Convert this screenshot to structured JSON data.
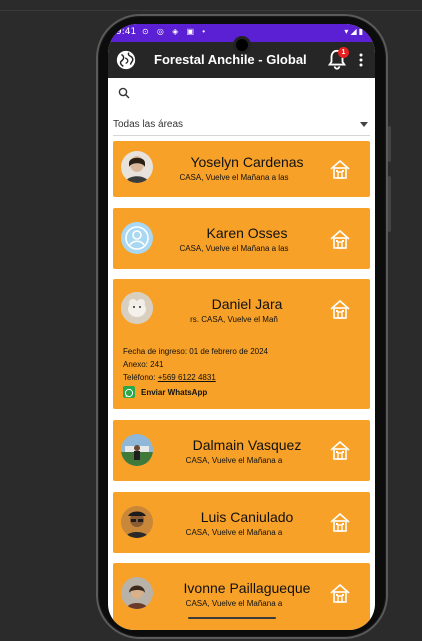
{
  "status": {
    "time": "9:41",
    "left_icons": "⊙ ◎ ◈ ▣ •",
    "right_icons": "▾◢▮"
  },
  "appbar": {
    "title": "Forestal Anchile - Global",
    "notification_count": "1",
    "globe_icon": "globe-icon",
    "bell_icon": "bell-icon",
    "menu_icon": "more-vert-icon"
  },
  "search": {
    "placeholder": "",
    "icon": "search-icon"
  },
  "filter": {
    "selected": "Todas las áreas"
  },
  "contacts": [
    {
      "name": "Yoselyn Cardenas",
      "subtitle": "CASA, Vuelve el Mañana a las"
    },
    {
      "name": "Karen Osses",
      "subtitle": "CASA, Vuelve el Mañana a las"
    },
    {
      "name": "Daniel Jara",
      "subtitle": "rs.                 CASA, Vuelve el Mañ",
      "details": {
        "ingreso": "Fecha de ingreso: 01 de febrero de 2024",
        "anexo": "Anexo: 241",
        "telefono_label": "Teléfono: ",
        "telefono": "+569 6122 4831",
        "whatsapp": "Enviar WhatsApp"
      }
    },
    {
      "name": "Dalmain Vasquez",
      "subtitle": "CASA, Vuelve el Mañana a"
    },
    {
      "name": "Luis Caniulado",
      "subtitle": "CASA, Vuelve el Mañana a"
    },
    {
      "name": "Ivonne Paillagueque",
      "subtitle": "CASA, Vuelve el Mañana a"
    }
  ],
  "colors": {
    "card": "#f7a128",
    "statusbar": "#5b1fd4",
    "appbar": "#262626",
    "whatsapp": "#2aa84a"
  }
}
